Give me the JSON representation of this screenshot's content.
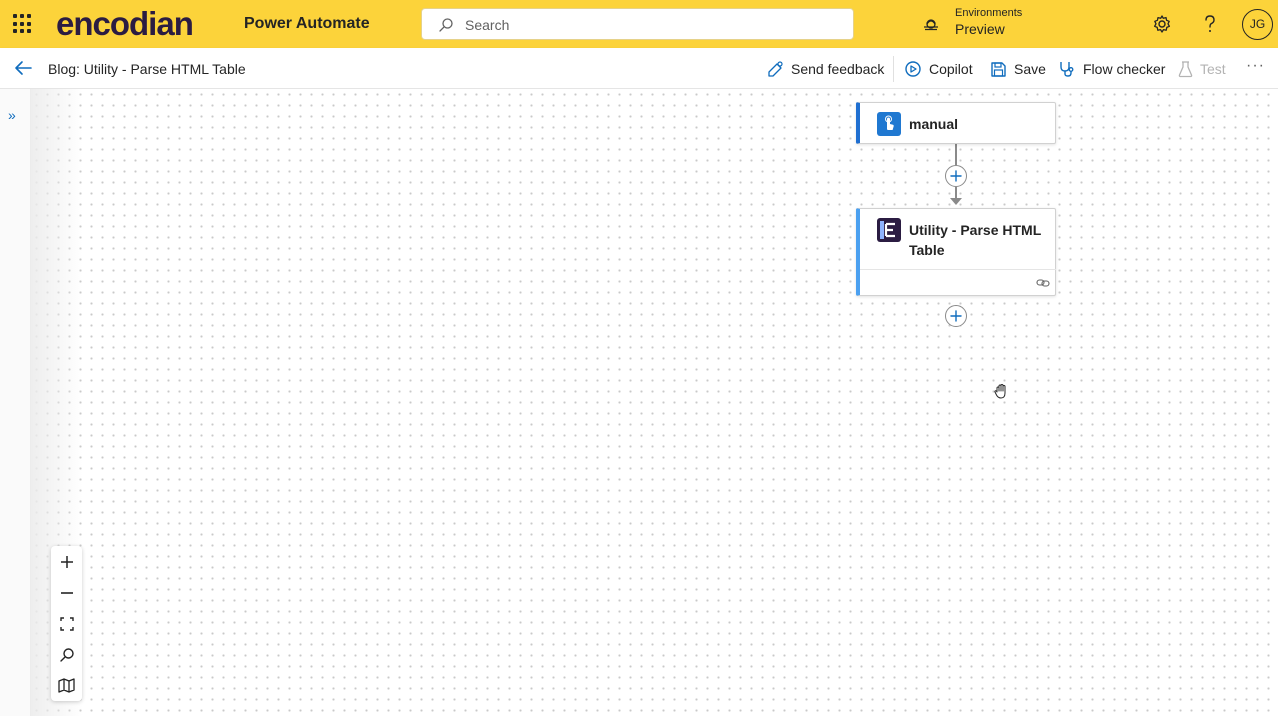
{
  "header": {
    "brand": "encodian",
    "app_name": "Power Automate",
    "search_placeholder": "Search",
    "environment_label": "Environments",
    "environment_value": "Preview",
    "avatar_initials": "JG",
    "bg_color": "#fcd33a"
  },
  "commandbar": {
    "flow_title": "Blog: Utility - Parse HTML Table",
    "send_feedback": "Send feedback",
    "copilot": "Copilot",
    "save": "Save",
    "flow_checker": "Flow checker",
    "test": "Test",
    "more": "···"
  },
  "rail": {
    "expand_glyph": "»"
  },
  "flow": {
    "trigger": {
      "title": "manual",
      "icon": "hand-touch-icon",
      "accent": "#1f6fd1"
    },
    "action": {
      "title": "Utility - Parse HTML Table",
      "icon": "encodian-logo-icon",
      "accent": "#4ba0f0"
    }
  },
  "zoom_controls": [
    "zoom-in",
    "zoom-out",
    "fit-view",
    "zoom-search",
    "minimap"
  ]
}
